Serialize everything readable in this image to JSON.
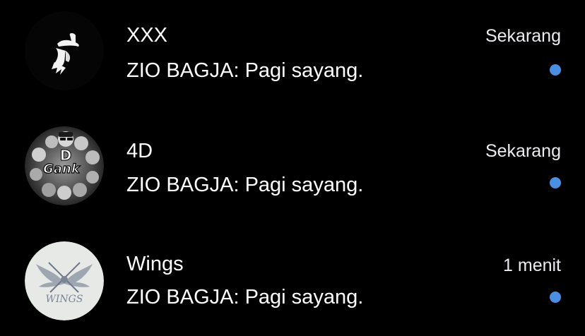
{
  "chats": [
    {
      "name": "XXX",
      "preview": "ZIO BAGJA: Pagi sayang.",
      "time": "Sekarang",
      "unread": true,
      "avatar_icon": "hat-silhouette-icon"
    },
    {
      "name": "4D",
      "preview": "ZIO BAGJA: Pagi sayang.",
      "time": "Sekarang",
      "unread": true,
      "avatar_icon": "gank-group-icon",
      "avatar_text": "Gank"
    },
    {
      "name": "Wings",
      "preview": "ZIO BAGJA: Pagi sayang.",
      "time": "1 menit",
      "unread": true,
      "avatar_icon": "wings-logo-icon",
      "avatar_text": "WINGS"
    }
  ],
  "colors": {
    "background": "#000000",
    "text": "#ffffff",
    "time_text": "#ebebf0",
    "unread_dot": "#4a90e2"
  }
}
